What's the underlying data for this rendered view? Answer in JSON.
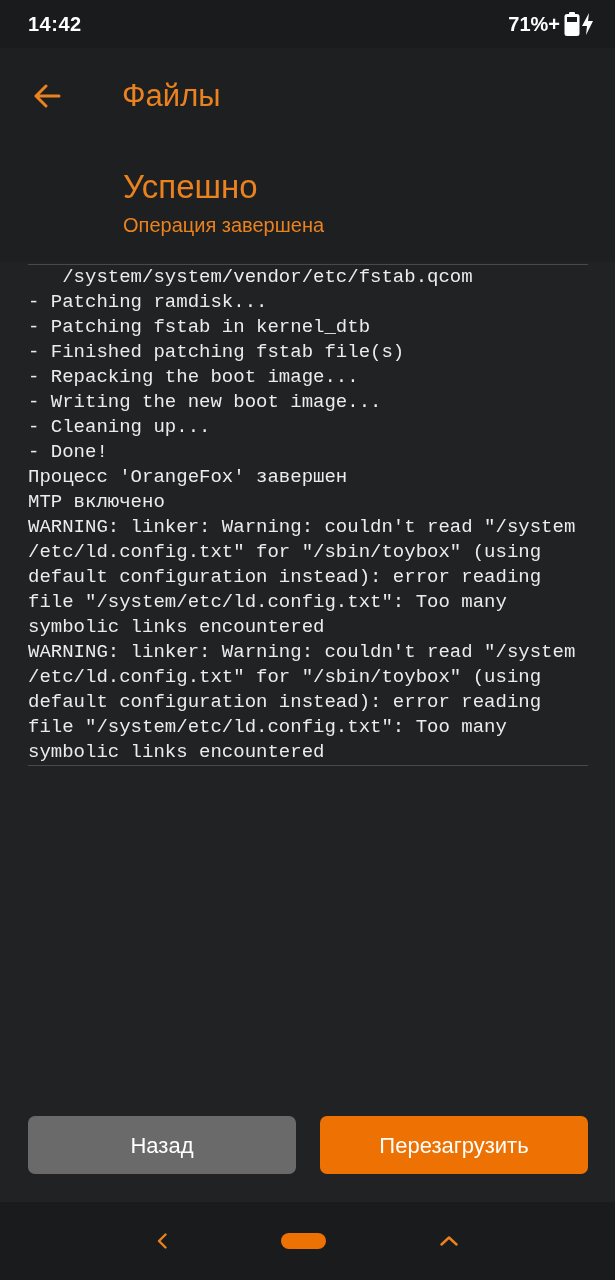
{
  "status_bar": {
    "time": "14:42",
    "battery": "71%+",
    "charging": true
  },
  "header": {
    "title": "Файлы"
  },
  "result": {
    "title": "Успешно",
    "subtitle": "Операция завершена"
  },
  "log": {
    "lines": [
      "   /system/system/vendor/etc/fstab.qcom",
      "- Patching ramdisk...",
      "- Patching fstab in kernel_dtb",
      "- Finished patching fstab file(s)",
      "- Repacking the boot image...",
      "- Writing the new boot image...",
      "- Cleaning up...",
      "- Done!",
      "Процесс 'OrangeFox' завершен",
      "MTP включено",
      "WARNING: linker: Warning: couldn't read \"/system",
      "/etc/ld.config.txt\" for \"/sbin/toybox\" (using",
      "default configuration instead): error reading",
      "file \"/system/etc/ld.config.txt\": Too many",
      "symbolic links encountered",
      "WARNING: linker: Warning: couldn't read \"/system",
      "/etc/ld.config.txt\" for \"/sbin/toybox\" (using",
      "default configuration instead): error reading",
      "file \"/system/etc/ld.config.txt\": Too many",
      "symbolic links encountered"
    ]
  },
  "buttons": [
    {
      "label": "Назад",
      "kind": "secondary"
    },
    {
      "label": "Перезагрузить",
      "kind": "primary"
    }
  ]
}
